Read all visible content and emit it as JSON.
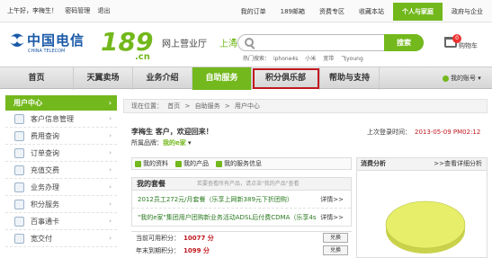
{
  "topbar": {
    "greeting": "上午好，",
    "user": "李梅生！",
    "change_pwd": "密码管理",
    "logout": "退出",
    "links": [
      "我的订单",
      "189邮箱",
      "资费专区",
      "收藏本站"
    ],
    "personal_tab": "个人与家庭",
    "gov_tab": "政府与企业"
  },
  "header": {
    "logo_cn": "中国电信",
    "logo_en": "CHINA TELECOM",
    "logo_189": "189",
    "logo_suffix": ".cn",
    "hall": "网上营业厅",
    "city": "上海",
    "search_button": "搜索",
    "hot_label": "热门搜索：",
    "hot_terms": [
      "iphone4s",
      "小米",
      "宽带",
      "飞young"
    ],
    "cart_count": "0",
    "cart_label": "购物车"
  },
  "nav": {
    "items": [
      "首页",
      "天翼卖场",
      "业务介绍",
      "自助服务",
      "积分俱乐部",
      "帮助与支持"
    ],
    "active_index": 3,
    "highlighted_index": 4,
    "account_label": "我的账号"
  },
  "sidebar": {
    "head": "用户中心",
    "items": [
      "客户信息管理",
      "费用查询",
      "订单查询",
      "充值交费",
      "业务办理",
      "积分服务",
      "百事通卡",
      "宽交付"
    ]
  },
  "breadcrumb": [
    "现在位置：",
    "首页",
    ">",
    "自助服务",
    ">",
    "用户中心"
  ],
  "welcome": {
    "text": "李梅生 客户，欢迎回来！",
    "brand_label": "所属品牌：",
    "brand": "我的e家"
  },
  "last_login": {
    "label": "上次登录时间：",
    "time": "2013-05-09 PM02:12"
  },
  "info_tabs": [
    "我的资料",
    "我的产品",
    "我的服务信息"
  ],
  "plan": {
    "title": "我的套餐",
    "hint": "若要查看所有产品，请点击\"我的产品\"查看",
    "rows": [
      {
        "text": "2012员工272元/月套餐（乐享上网新389元下折团购）",
        "detail": "详情>>"
      },
      {
        "text": "\"我的e家\"集团用户团购新业务活动ADSL后付费CDMA（乐享4s",
        "detail": "详情>>"
      }
    ]
  },
  "points": {
    "rows": [
      {
        "label": "当前可用积分：",
        "value": "10077 分",
        "button": "兑换"
      },
      {
        "label": "年末到期积分：",
        "value": "1099 分",
        "button": "兑换"
      }
    ]
  },
  "consumption": {
    "title": "消费分析",
    "detail": ">>查看详细分析",
    "color": "#e6ee6a"
  },
  "colors": {
    "brand_green": "#73b81c",
    "telecom_blue": "#1a5aa8",
    "highlight_red": "#c0181f"
  }
}
